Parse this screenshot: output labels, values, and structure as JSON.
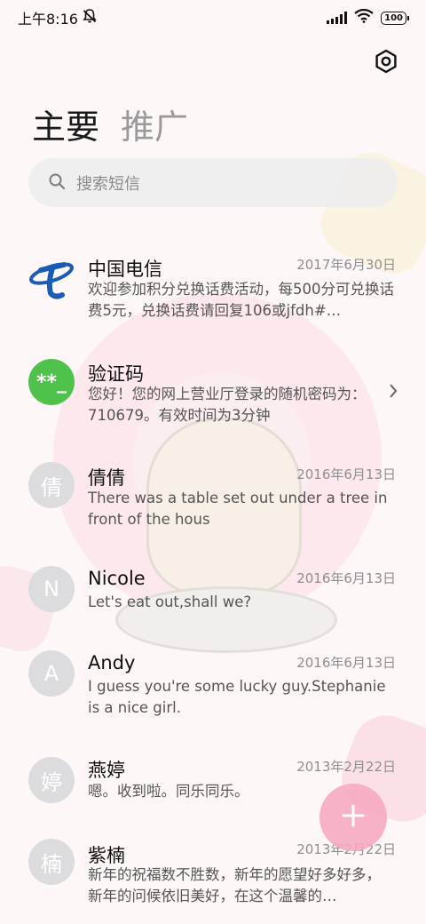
{
  "status_bar": {
    "time": "上午8:16",
    "battery": "100",
    "icons": [
      "mute-icon",
      "signal-icon",
      "wifi-icon",
      "battery-icon"
    ]
  },
  "header": {
    "settings_icon": "settings-icon",
    "tabs": [
      {
        "label": "主要",
        "active": true
      },
      {
        "label": "推广",
        "active": false
      }
    ]
  },
  "search": {
    "placeholder": "搜索短信",
    "icon": "search-icon"
  },
  "conversations": [
    {
      "name": "中国电信",
      "date": "2017年6月30日",
      "preview": "欢迎参加积分兑换话费活动，每500分可兑换话费5元，兑换话费请回复106或jfdh#…",
      "avatar": "china-telecom-logo"
    },
    {
      "name": "验证码",
      "date": "",
      "preview": "您好！您的网上营业厅登录的随机密码为：710679。有效时间为3分钟",
      "avatar": "**_"
    },
    {
      "name": "倩倩",
      "date": "2016年6月13日",
      "preview": "There was a table set out under a tree in front of the hous",
      "avatar": "倩"
    },
    {
      "name": "Nicole",
      "date": "2016年6月13日",
      "preview": "Let's eat out,shall we?",
      "avatar": "N"
    },
    {
      "name": "Andy",
      "date": "2016年6月13日",
      "preview": "I guess you're some lucky guy.Stephanie is a nice girl.",
      "avatar": "A"
    },
    {
      "name": "燕婷",
      "date": "2013年2月22日",
      "preview": "嗯。收到啦。同乐同乐。",
      "avatar": "婷"
    },
    {
      "name": "紫楠",
      "date": "2013年2月22日",
      "preview": "新年的祝福数不胜数，新年的愿望好多好多，新年的问候依旧美好，在这个温馨的…",
      "avatar": "楠"
    }
  ],
  "fab": {
    "icon": "plus-icon"
  },
  "colors": {
    "accent_fab": "#f7a9bf",
    "avatar_green": "#4fc24b",
    "avatar_gray": "#dcdcdf"
  }
}
